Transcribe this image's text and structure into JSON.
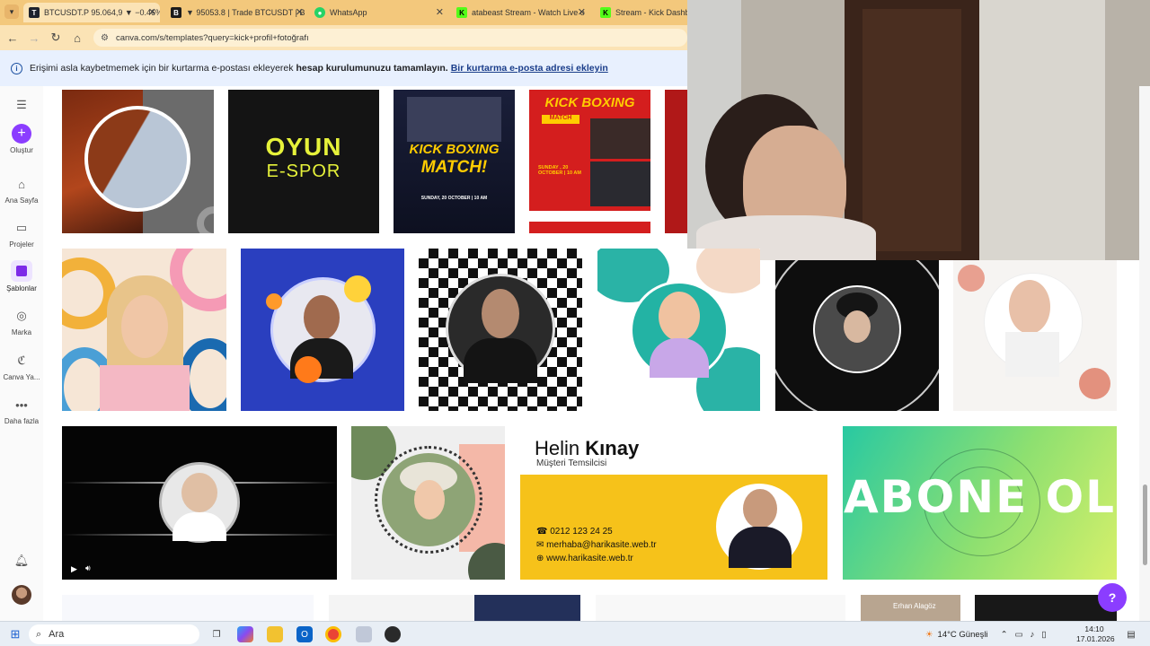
{
  "browser": {
    "tabs": [
      {
        "title": "BTCUSDT.P 95.064,9 ▼ −0.46%",
        "icon": "tradingview-icon"
      },
      {
        "title": "▼ 95053.8 | Trade BTCUSDT | B",
        "icon": "exchange-icon"
      },
      {
        "title": "WhatsApp",
        "icon": "whatsapp-icon"
      },
      {
        "title": "atabeast Stream - Watch Live o",
        "icon": "kick-icon"
      },
      {
        "title": "Stream - Kick Dashboar",
        "icon": "kick-icon"
      }
    ],
    "url": "canva.com/s/templates?query=kick+profil+fotoğrafı"
  },
  "banner": {
    "text_a": "Erişimi asla kaybetmemek için bir kurtarma e-postası ekleyerek",
    "text_b": "hesap kurulumunuzu tamamlayın.",
    "link": "Bir kurtarma e-posta adresi ekleyin"
  },
  "sidebar": {
    "items": [
      {
        "label": "Oluştur"
      },
      {
        "label": "Ana Sayfa"
      },
      {
        "label": "Projeler"
      },
      {
        "label": "Şablonlar"
      },
      {
        "label": "Marka"
      },
      {
        "label": "Canva Ya..."
      },
      {
        "label": "Daha fazla"
      }
    ]
  },
  "templates": {
    "oyun_title": "OYUN",
    "oyun_sub": "E-SPOR",
    "kick1_line1": "KICK BOXING",
    "kick1_line2": "MATCH!",
    "kick1_date": "SUNDAY, 20 OCTOBER | 10 AM",
    "kick2_title": "KICK BOXING",
    "kick2_badge": "MATCH",
    "kick2_date": "SUNDAY , 20 OCTOBER | 10 AM",
    "card_name_first": "Helin",
    "card_name_last": "Kınay",
    "card_role": "Müşteri Temsilcisi",
    "card_phone": "0212 123 24 25",
    "card_email": "merhaba@harikasite.web.tr",
    "card_web": "www.harikasite.web.tr",
    "abone": "ABONE OL",
    "erhan": "Erhan Alagöz"
  },
  "taskbar": {
    "search_placeholder": "Ara",
    "weather": "14°C Güneşli",
    "time": "14:10",
    "date": "17.01.2026"
  },
  "colors": {
    "canva_purple": "#8b3dff",
    "tab_strip": "#f3c87c",
    "toolbar": "#fbe3b5",
    "banner_bg": "#e8f0fe"
  }
}
